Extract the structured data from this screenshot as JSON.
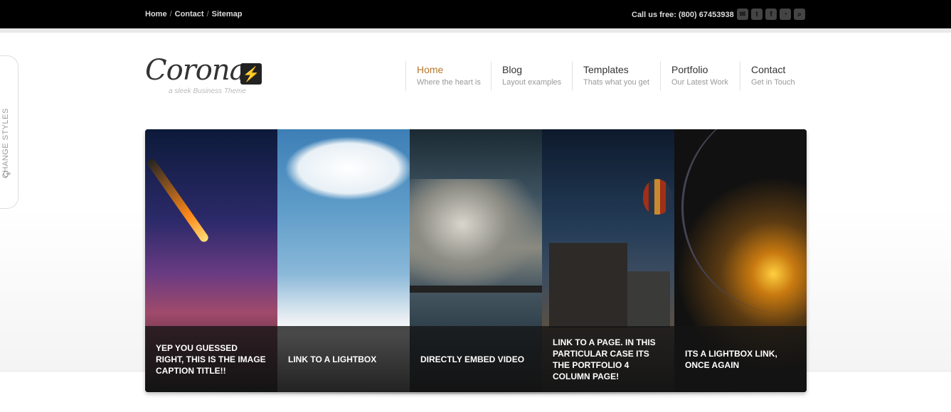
{
  "topbar": {
    "breadcrumbs": [
      "Home",
      "Contact",
      "Sitemap"
    ],
    "separator": "/",
    "phone": "Call us free: (800) 67453938",
    "social_icons": [
      {
        "name": "email-icon",
        "glyph": "✉"
      },
      {
        "name": "twitter-icon",
        "glyph": "t"
      },
      {
        "name": "facebook-icon",
        "glyph": "f"
      },
      {
        "name": "rss-icon",
        "glyph": "◔"
      },
      {
        "name": "search-icon",
        "glyph": "⌕"
      }
    ]
  },
  "style_switcher": {
    "label": "CHANGE STYLES",
    "icon": "refresh-icon",
    "glyph": "⟳"
  },
  "logo": {
    "word": "Corona",
    "bolt": "⚡",
    "tagline": "a sleek Business Theme"
  },
  "nav": {
    "items": [
      {
        "title": "Home",
        "subtitle": "Where the heart is",
        "active": true
      },
      {
        "title": "Blog",
        "subtitle": "Layout examples"
      },
      {
        "title": "Templates",
        "subtitle": "Thats what you get"
      },
      {
        "title": "Portfolio",
        "subtitle": "Our Latest Work"
      },
      {
        "title": "Contact",
        "subtitle": "Get in Touch"
      }
    ],
    "active_color": "#b5782c"
  },
  "slider": {
    "panels": [
      {
        "caption": "YEP YOU GUESSED RIGHT, THIS IS THE IMAGE CAPTION TITLE!!"
      },
      {
        "caption": "LINK TO A LIGHTBOX"
      },
      {
        "caption": "DIRECTLY EMBED VIDEO"
      },
      {
        "caption": "LINK TO A PAGE. IN THIS PARTICULAR CASE ITS THE PORTFOLIO 4 COLUMN PAGE!"
      },
      {
        "caption": "ITS A LIGHTBOX LINK, ONCE AGAIN"
      }
    ]
  }
}
